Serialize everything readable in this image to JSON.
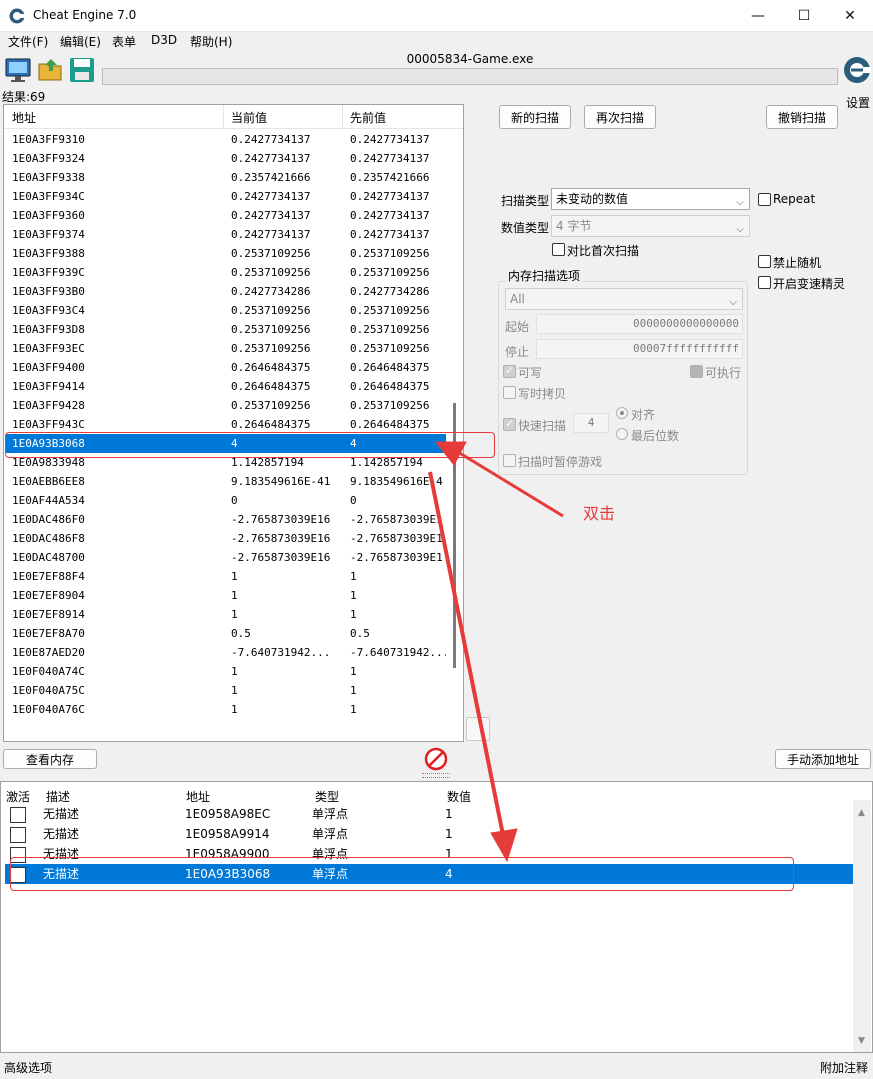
{
  "window": {
    "title": "Cheat Engine 7.0",
    "controls": {
      "minimize": "—",
      "maximize": "☐",
      "close": "✕"
    }
  },
  "menu": [
    "文件(F)",
    "编辑(E)",
    "表单",
    "D3D",
    "帮助(H)"
  ],
  "toolbar": {
    "icons": [
      "monitor-icon",
      "open-folder-icon",
      "save-disk-icon"
    ],
    "process_title": "00005834-Game.exe",
    "settings_label": "设置"
  },
  "results": {
    "count_label": "结果:69"
  },
  "found_list": {
    "columns": [
      "地址",
      "当前值",
      "先前值"
    ],
    "rows": [
      [
        "1E0A3FF9310",
        "0.2427734137",
        "0.2427734137"
      ],
      [
        "1E0A3FF9324",
        "0.2427734137",
        "0.2427734137"
      ],
      [
        "1E0A3FF9338",
        "0.2357421666",
        "0.2357421666"
      ],
      [
        "1E0A3FF934C",
        "0.2427734137",
        "0.2427734137"
      ],
      [
        "1E0A3FF9360",
        "0.2427734137",
        "0.2427734137"
      ],
      [
        "1E0A3FF9374",
        "0.2427734137",
        "0.2427734137"
      ],
      [
        "1E0A3FF9388",
        "0.2537109256",
        "0.2537109256"
      ],
      [
        "1E0A3FF939C",
        "0.2537109256",
        "0.2537109256"
      ],
      [
        "1E0A3FF93B0",
        "0.2427734286",
        "0.2427734286"
      ],
      [
        "1E0A3FF93C4",
        "0.2537109256",
        "0.2537109256"
      ],
      [
        "1E0A3FF93D8",
        "0.2537109256",
        "0.2537109256"
      ],
      [
        "1E0A3FF93EC",
        "0.2537109256",
        "0.2537109256"
      ],
      [
        "1E0A3FF9400",
        "0.2646484375",
        "0.2646484375"
      ],
      [
        "1E0A3FF9414",
        "0.2646484375",
        "0.2646484375"
      ],
      [
        "1E0A3FF9428",
        "0.2537109256",
        "0.2537109256"
      ],
      [
        "1E0A3FF943C",
        "0.2646484375",
        "0.2646484375"
      ],
      [
        "1E0A93B3068",
        "4",
        "4"
      ],
      [
        "1E0A9833948",
        "1.142857194",
        "1.142857194"
      ],
      [
        "1E0AEBB6EE8",
        "9.183549616E-41",
        "9.183549616E-4"
      ],
      [
        "1E0AF44A534",
        "0",
        "0"
      ],
      [
        "1E0DAC486F0",
        "-2.765873039E16",
        "-2.765873039E1"
      ],
      [
        "1E0DAC486F8",
        "-2.765873039E16",
        "-2.765873039E1"
      ],
      [
        "1E0DAC48700",
        "-2.765873039E16",
        "-2.765873039E1"
      ],
      [
        "1E0E7EF88F4",
        "1",
        "1"
      ],
      [
        "1E0E7EF8904",
        "1",
        "1"
      ],
      [
        "1E0E7EF8914",
        "1",
        "1"
      ],
      [
        "1E0E7EF8A70",
        "0.5",
        "0.5"
      ],
      [
        "1E0E87AED20",
        "-7.640731942...",
        "-7.640731942..."
      ],
      [
        "1E0F040A74C",
        "1",
        "1"
      ],
      [
        "1E0F040A75C",
        "1",
        "1"
      ],
      [
        "1E0F040A76C",
        "1",
        "1"
      ]
    ],
    "selected_index": 16
  },
  "buttons": {
    "new_scan": "新的扫描",
    "next_scan": "再次扫描",
    "undo_scan": "撤销扫描",
    "view_memory": "查看内存",
    "add_address": "手动添加地址"
  },
  "scan_options": {
    "scan_type_label": "扫描类型",
    "scan_type_value": "未变动的数值",
    "value_type_label": "数值类型",
    "value_type_value": "4 字节",
    "compare_first": "对比首次扫描",
    "repeat": "Repeat",
    "disable_random": "禁止随机",
    "speedhack": "开启变速精灵"
  },
  "memory_options": {
    "title": "内存扫描选项",
    "region": "All",
    "start_label": "起始",
    "start_value": "0000000000000000",
    "stop_label": "停止",
    "stop_value": "00007fffffffffff",
    "writable": "可写",
    "executable": "可执行",
    "copy_on_write": "写时拷贝",
    "fast_scan": "快速扫描",
    "fast_scan_value": "4",
    "align": "对齐",
    "last_digits": "最后位数",
    "pause_game": "扫描时暂停游戏"
  },
  "address_list": {
    "columns": [
      "激活",
      "描述",
      "地址",
      "类型",
      "数值"
    ],
    "rows": [
      [
        "无描述",
        "1E0958A98EC",
        "单浮点",
        "1"
      ],
      [
        "无描述",
        "1E0958A9914",
        "单浮点",
        "1"
      ],
      [
        "无描述",
        "1E0958A9900",
        "单浮点",
        "1"
      ],
      [
        "无描述",
        "1E0A93B3068",
        "单浮点",
        "4"
      ]
    ],
    "selected_index": 3
  },
  "status": {
    "left": "高级选项",
    "right": "附加注释"
  },
  "annotation": {
    "text": "双击",
    "color": "#e63b3b"
  },
  "colors": {
    "selection": "#0078d7",
    "annotation": "#e63b3b"
  }
}
